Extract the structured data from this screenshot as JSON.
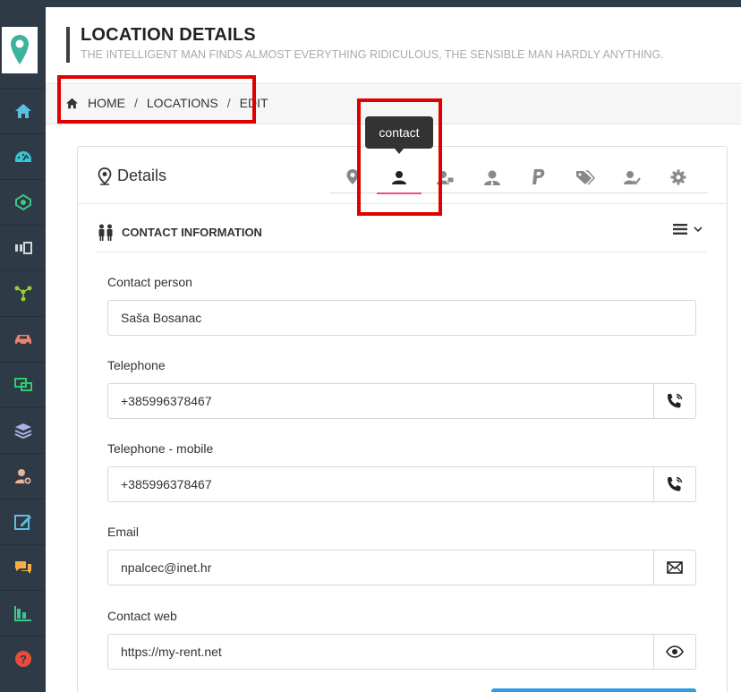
{
  "header": {
    "title": "LOCATION DETAILS",
    "subtitle": "THE INTELLIGENT MAN FINDS ALMOST EVERYTHING RIDICULOUS, THE SENSIBLE MAN HARDLY ANYTHING."
  },
  "breadcrumb": {
    "items": [
      "HOME",
      "LOCATIONS",
      "EDIT"
    ],
    "separator": "/"
  },
  "sidebar": {
    "items": [
      {
        "icon": "home-icon",
        "color": "#5bc0de"
      },
      {
        "icon": "dashboard-icon",
        "color": "#36c6d3"
      },
      {
        "icon": "network-icon",
        "color": "#3cc68a"
      },
      {
        "icon": "dispatch-icon",
        "color": "#cfd8dc"
      },
      {
        "icon": "hierarchy-icon",
        "color": "#9acd32"
      },
      {
        "icon": "car-icon",
        "color": "#f0826b"
      },
      {
        "icon": "transfer-icon",
        "color": "#2ecc71"
      },
      {
        "icon": "layers-icon",
        "color": "#a8b3e6"
      },
      {
        "icon": "add-user-icon",
        "color": "#e8b49a"
      },
      {
        "icon": "edit-icon",
        "color": "#5bc0de"
      },
      {
        "icon": "chat-icon",
        "color": "#f5b041"
      },
      {
        "icon": "chart-icon",
        "color": "#3cc68a"
      },
      {
        "icon": "help-icon",
        "color": "#e74c3c"
      }
    ]
  },
  "card": {
    "title": "Details"
  },
  "tabs": [
    {
      "icon": "location-pin-icon"
    },
    {
      "icon": "contact-person-icon",
      "active": true
    },
    {
      "icon": "user-card-icon"
    },
    {
      "icon": "user-tie-icon"
    },
    {
      "icon": "paypal-icon"
    },
    {
      "icon": "tags-icon"
    },
    {
      "icon": "user-check-icon"
    },
    {
      "icon": "gear-icon"
    }
  ],
  "tooltip": {
    "text": "contact"
  },
  "section": {
    "label": "CONTACT INFORMATION"
  },
  "form": {
    "contact_person": {
      "label": "Contact person",
      "value": "Saša Bosanac"
    },
    "telephone": {
      "label": "Telephone",
      "value": "+385996378467"
    },
    "mobile": {
      "label": "Telephone - mobile",
      "value": "+385996378467"
    },
    "email": {
      "label": "Email",
      "value": "npalcec@inet.hr"
    },
    "web": {
      "label": "Contact web",
      "value": "https://my-rent.net"
    }
  },
  "colors": {
    "sidebar_bg": "#2e3a45",
    "accent_tab": "#e8508a",
    "highlight_box": "#e00000",
    "primary_button": "#2f9be0"
  }
}
